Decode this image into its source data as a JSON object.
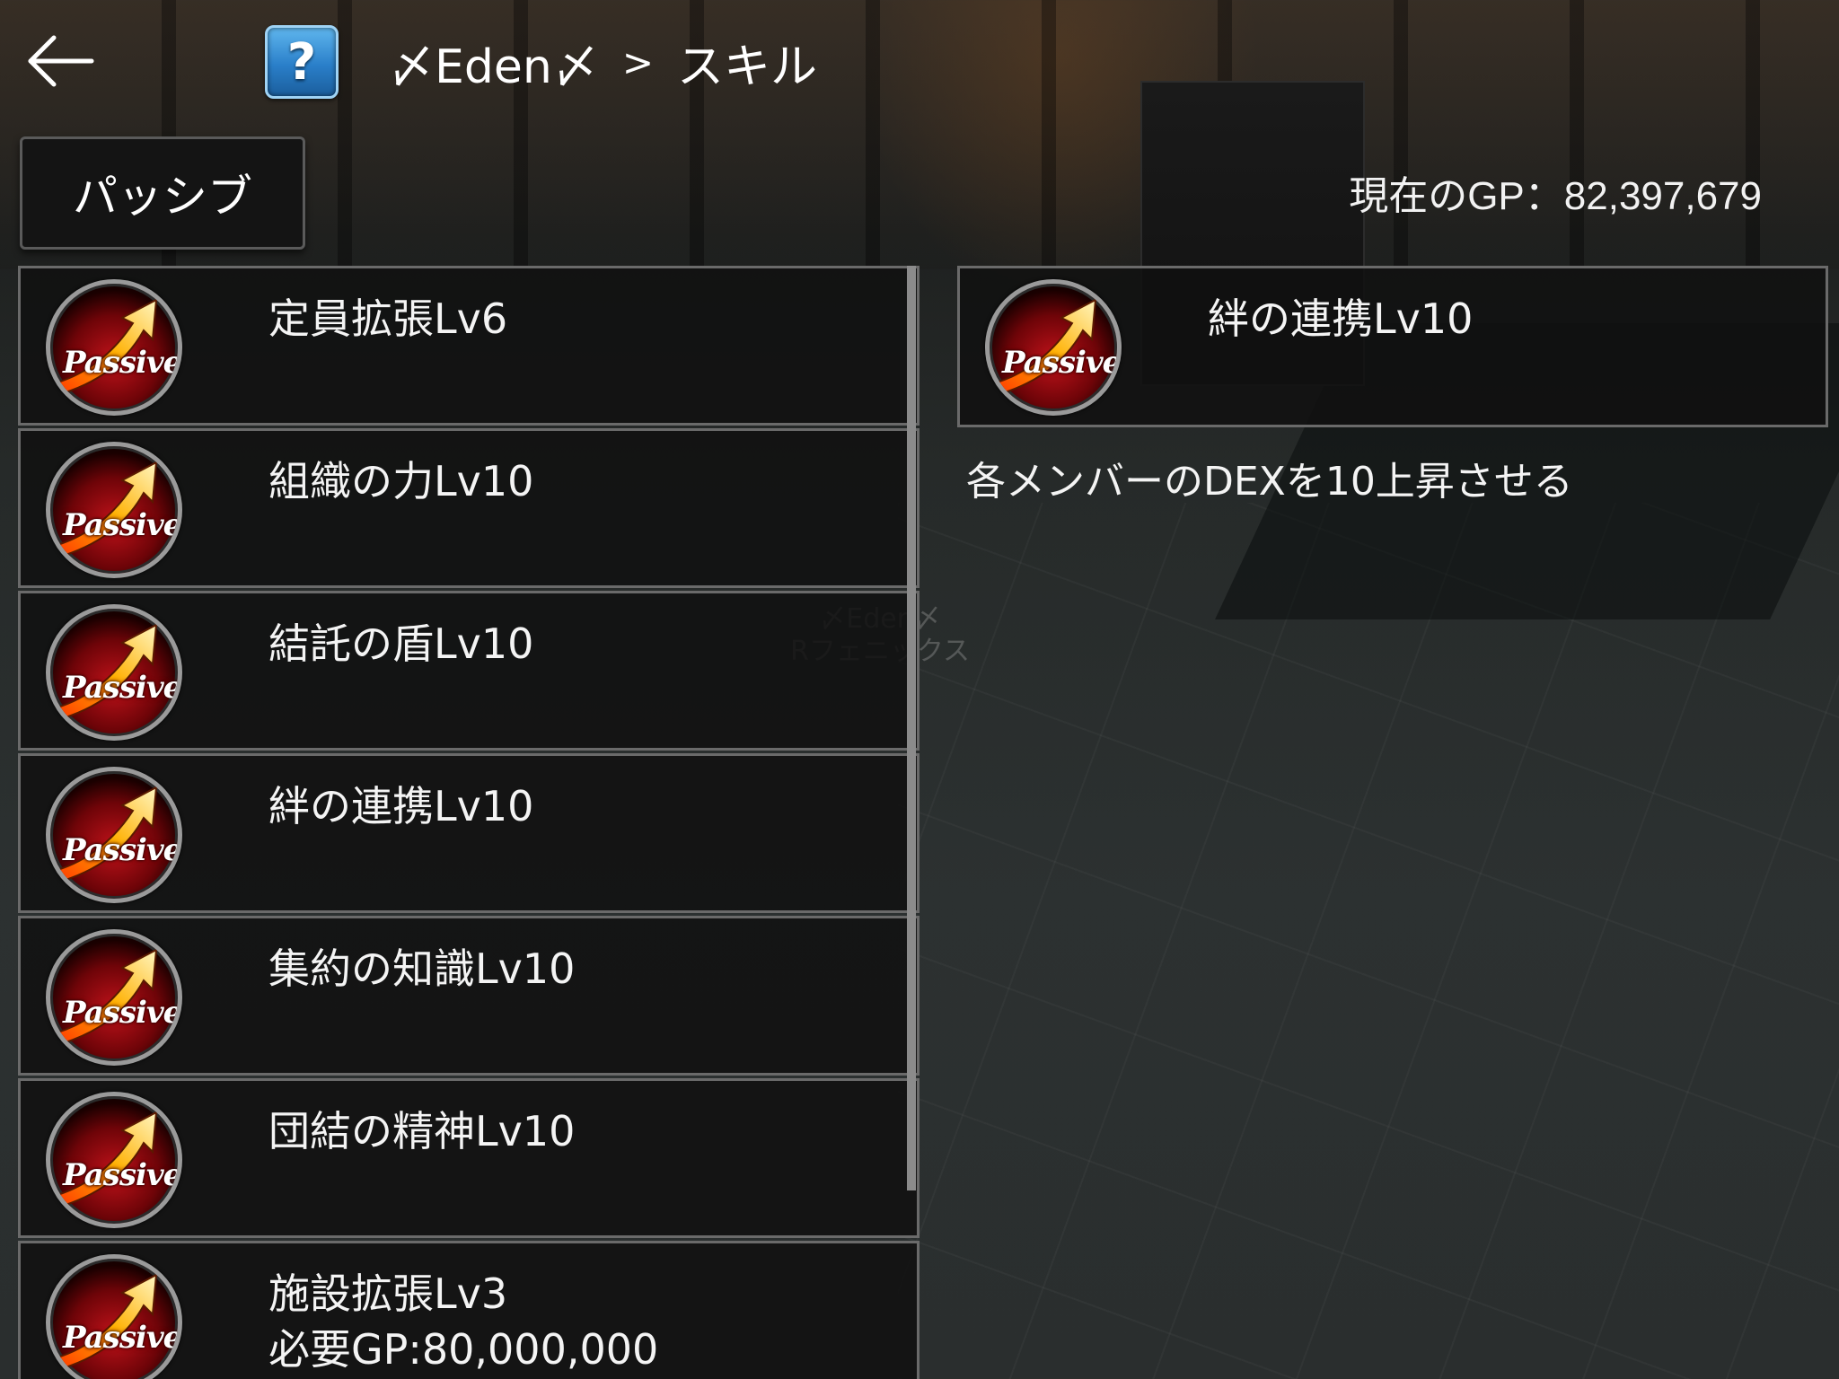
{
  "header": {
    "guild_name": "〆Eden〆",
    "separator": ">",
    "page_title": "スキル",
    "help_label": "?"
  },
  "tabs": [
    {
      "label": "パッシブ",
      "selected": true
    }
  ],
  "gp": {
    "label": "現在のGP：82,397,679"
  },
  "skill_icon": {
    "label": "Passive",
    "icon": "passive-arrow-icon"
  },
  "skills": [
    {
      "name": "定員拡張Lv6"
    },
    {
      "name": "組織の力Lv10"
    },
    {
      "name": "結託の盾Lv10"
    },
    {
      "name": "絆の連携Lv10"
    },
    {
      "name": "集約の知識Lv10"
    },
    {
      "name": "団結の精神Lv10"
    },
    {
      "name": "施設拡張Lv3",
      "cost": "必要GP:80,000,000"
    }
  ],
  "detail": {
    "name": "絆の連携Lv10",
    "description": "各メンバーのDEXを10上昇させる"
  },
  "background_text": {
    "player_guild": "〆Eden〆",
    "player_name": "Rフェニックス"
  }
}
